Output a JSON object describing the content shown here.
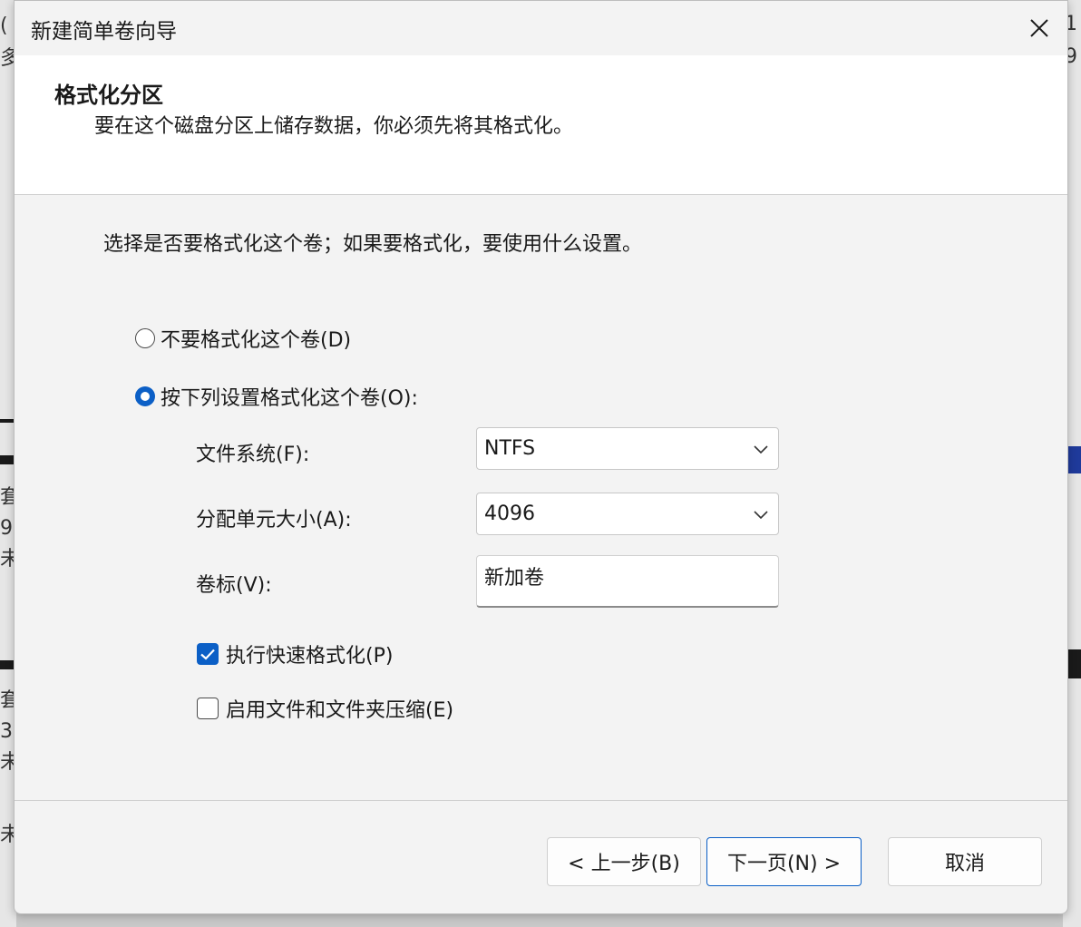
{
  "dialog": {
    "title": "新建简单卷向导",
    "header_title": "格式化分区",
    "header_subtitle": "要在这个磁盘分区上储存数据，你必须先将其格式化。",
    "intro": "选择是否要格式化这个卷；如果要格式化，要使用什么设置。"
  },
  "options": {
    "no_format": {
      "label": "不要格式化这个卷(D)",
      "selected": false
    },
    "format": {
      "label": "按下列设置格式化这个卷(O):",
      "selected": true
    }
  },
  "fields": {
    "filesystem": {
      "label": "文件系统(F):",
      "value": "NTFS"
    },
    "allocation": {
      "label": "分配单元大小(A):",
      "value": "4096"
    },
    "volume_label": {
      "label": "卷标(V):",
      "value": "新加卷"
    }
  },
  "checkboxes": {
    "quick_format": {
      "label": "执行快速格式化(P)",
      "checked": true
    },
    "compression": {
      "label": "启用文件和文件夹压缩(E)",
      "checked": false
    }
  },
  "buttons": {
    "back": "< 上一步(B)",
    "next": "下一页(N) >",
    "cancel": "取消"
  },
  "background_fragments": {
    "left": [
      "(",
      "多",
      "套",
      "9",
      "未",
      "套",
      "3",
      "未",
      "未"
    ],
    "right": [
      "1",
      "9"
    ]
  },
  "colors": {
    "accent": "#0b5fc6",
    "header_bg": "#ffffff",
    "body_bg": "#f3f3f3"
  }
}
